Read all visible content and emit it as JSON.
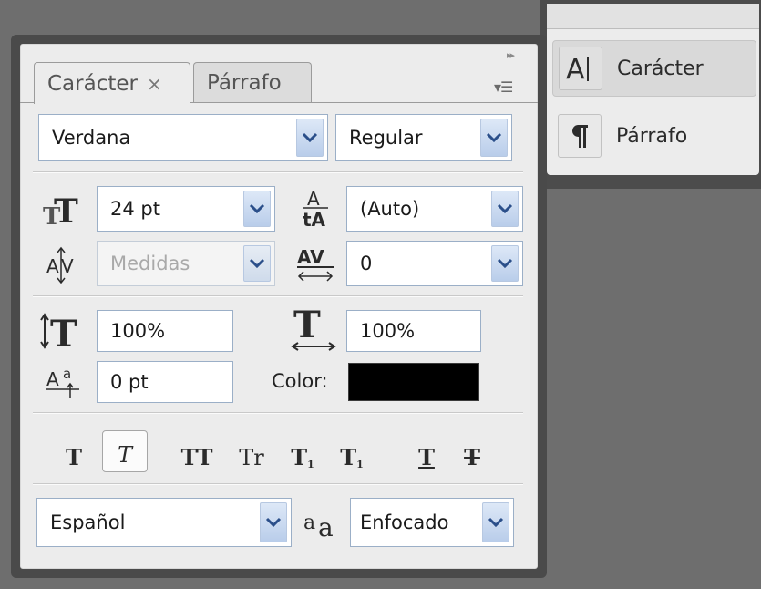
{
  "panel": {
    "collapse_glyph": "▸▸",
    "menu_glyph": "▾☰",
    "tabs": [
      {
        "label": "Carácter",
        "close": "×"
      },
      {
        "label": "Párrafo"
      }
    ]
  },
  "font": {
    "family": "Verdana",
    "style": "Regular"
  },
  "metrics": {
    "size": "24 pt",
    "leading": "(Auto)",
    "kerning": "Medidas",
    "tracking": "0",
    "vertical_scale": "100%",
    "horizontal_scale": "100%",
    "baseline_shift": "0 pt",
    "color_label": "Color:",
    "color_value": "#000000"
  },
  "style_buttons": [
    {
      "name": "faux-bold",
      "glyph": "T"
    },
    {
      "name": "faux-italic",
      "glyph": "T",
      "active": true
    },
    {
      "name": "all-caps",
      "glyph": "TT"
    },
    {
      "name": "small-caps",
      "glyph": "Tr"
    },
    {
      "name": "superscript",
      "glyph": "T"
    },
    {
      "name": "subscript",
      "glyph": "T"
    },
    {
      "name": "underline",
      "glyph": "T"
    },
    {
      "name": "strikethrough",
      "glyph": "T"
    }
  ],
  "superscript_mark": "1",
  "subscript_mark": "1",
  "language": "Español",
  "antialias": {
    "icon_text": "aa",
    "value": "Enfocado"
  },
  "dock": {
    "items": [
      {
        "label": "Carácter",
        "icon": "character-panel-icon",
        "selected": true
      },
      {
        "label": "Párrafo",
        "icon": "paragraph-panel-icon",
        "selected": false
      }
    ]
  }
}
